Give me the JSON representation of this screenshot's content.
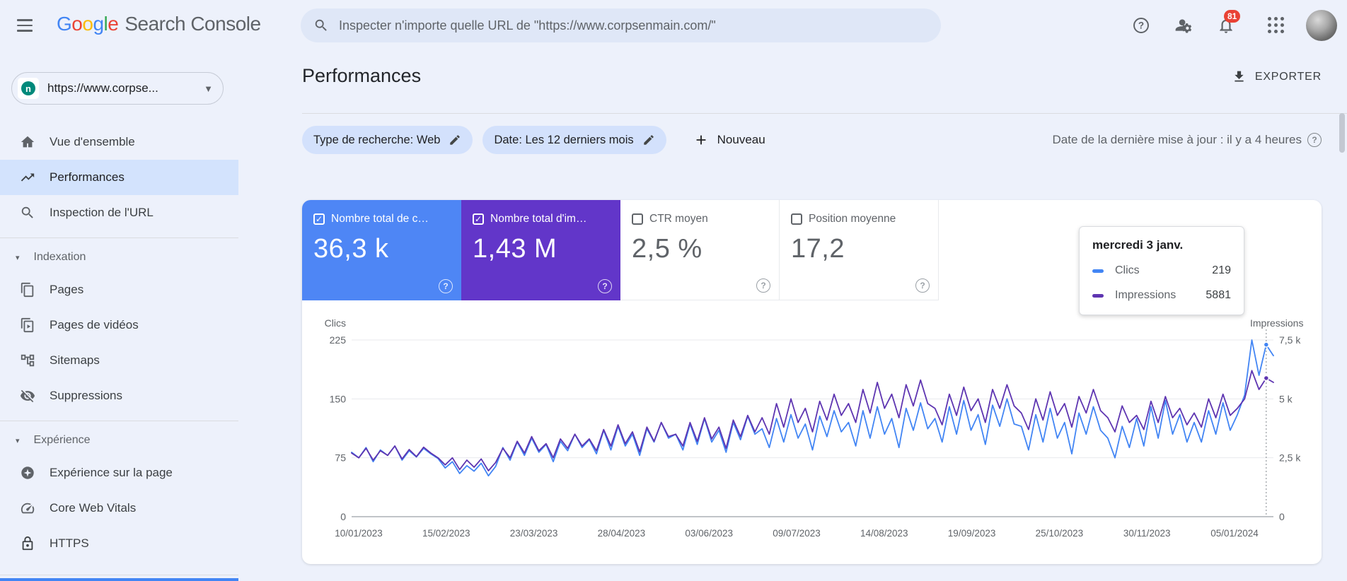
{
  "topbar": {
    "logo": {
      "letters": [
        [
          "G",
          "#4285F4"
        ],
        [
          "o",
          "#EA4335"
        ],
        [
          "o",
          "#FBBC05"
        ],
        [
          "g",
          "#4285F4"
        ],
        [
          "l",
          "#34A853"
        ],
        [
          "e",
          "#EA4335"
        ]
      ],
      "product": "Search Console"
    },
    "search_placeholder": "Inspecter n'importe quelle URL de \"https://www.corpsenmain.com/\"",
    "notifications_count": "81"
  },
  "sidebar": {
    "property_label": "https://www.corpse...",
    "sections": [
      {
        "items": [
          {
            "icon": "home",
            "label": "Vue d'ensemble"
          },
          {
            "icon": "performance",
            "label": "Performances",
            "selected": true
          },
          {
            "icon": "url-inspection",
            "label": "Inspection de l'URL"
          }
        ]
      },
      {
        "header": "Indexation",
        "items": [
          {
            "icon": "pages",
            "label": "Pages"
          },
          {
            "icon": "video-pages",
            "label": "Pages de vidéos"
          },
          {
            "icon": "sitemaps",
            "label": "Sitemaps"
          },
          {
            "icon": "removals",
            "label": "Suppressions"
          }
        ]
      },
      {
        "header": "Expérience",
        "items": [
          {
            "icon": "page-experience",
            "label": "Expérience sur la page"
          },
          {
            "icon": "core-web-vitals",
            "label": "Core Web Vitals"
          },
          {
            "icon": "https",
            "label": "HTTPS"
          }
        ]
      }
    ]
  },
  "main": {
    "title": "Performances",
    "export_label": "EXPORTER",
    "filters": [
      {
        "label": "Type de recherche: Web"
      },
      {
        "label": "Date: Les 12 derniers mois"
      }
    ],
    "new_filter_label": "Nouveau",
    "last_update": "Date de la dernière mise à jour : il y a 4 heures",
    "cards": [
      {
        "label": "Nombre total de c…",
        "value": "36,3 k",
        "checked": true,
        "bg": "#4e86f5",
        "fg": "#ffffff"
      },
      {
        "label": "Nombre total d'im…",
        "value": "1,43 M",
        "checked": true,
        "bg": "#6236c9",
        "fg": "#ffffff"
      },
      {
        "label": "CTR moyen",
        "value": "2,5 %",
        "checked": false,
        "bg": "#ffffff",
        "fg": "#5f6368"
      },
      {
        "label": "Position moyenne",
        "value": "17,2",
        "checked": false,
        "bg": "#ffffff",
        "fg": "#5f6368"
      }
    ],
    "tooltip": {
      "title": "mercredi 3 janv.",
      "rows": [
        {
          "label": "Clics",
          "value": "219",
          "color": "#4285f4"
        },
        {
          "label": "Impressions",
          "value": "5881",
          "color": "#5e35b1"
        }
      ]
    }
  },
  "chart_data": {
    "type": "line",
    "title": "",
    "grid": true,
    "legend_position": "none",
    "left_axis": {
      "label": "Clics",
      "ticks": [
        "225",
        "150",
        "75",
        "0"
      ],
      "max": 225
    },
    "right_axis": {
      "label": "Impressions",
      "ticks": [
        "7,5 k",
        "5 k",
        "2,5 k",
        "0"
      ],
      "max": 7500
    },
    "x_labels": [
      "10/01/2023",
      "15/02/2023",
      "23/03/2023",
      "28/04/2023",
      "03/06/2023",
      "09/07/2023",
      "14/08/2023",
      "19/09/2023",
      "25/10/2023",
      "30/11/2023",
      "05/01/2024"
    ],
    "hover_index": 127,
    "series": [
      {
        "name": "Clics",
        "color": "#4285f4",
        "axis": "left",
        "max": 225,
        "values": [
          82,
          75,
          88,
          70,
          85,
          78,
          90,
          72,
          84,
          76,
          87,
          80,
          74,
          62,
          70,
          55,
          65,
          58,
          68,
          52,
          64,
          88,
          72,
          95,
          78,
          100,
          82,
          92,
          70,
          96,
          84,
          105,
          88,
          98,
          80,
          110,
          85,
          115,
          90,
          105,
          78,
          112,
          95,
          120,
          100,
          105,
          85,
          118,
          92,
          125,
          95,
          110,
          82,
          120,
          98,
          128,
          105,
          112,
          88,
          125,
          95,
          130,
          100,
          118,
          85,
          128,
          102,
          135,
          108,
          120,
          90,
          135,
          100,
          140,
          105,
          125,
          88,
          138,
          110,
          145,
          112,
          125,
          95,
          140,
          105,
          148,
          110,
          130,
          92,
          142,
          115,
          150,
          118,
          115,
          85,
          130,
          95,
          138,
          100,
          120,
          80,
          132,
          105,
          140,
          110,
          100,
          75,
          115,
          88,
          125,
          90,
          140,
          100,
          148,
          105,
          130,
          95,
          120,
          95,
          135,
          105,
          145,
          110,
          130,
          155,
          225,
          180,
          219,
          205
        ]
      },
      {
        "name": "Impressions",
        "color": "#5e35b1",
        "axis": "right",
        "max": 7500,
        "values": [
          2700,
          2500,
          2900,
          2400,
          2800,
          2600,
          3000,
          2450,
          2850,
          2550,
          2950,
          2700,
          2500,
          2200,
          2500,
          2000,
          2400,
          2100,
          2450,
          1950,
          2300,
          2900,
          2500,
          3200,
          2700,
          3400,
          2800,
          3100,
          2500,
          3300,
          2900,
          3500,
          3000,
          3300,
          2800,
          3700,
          3000,
          3900,
          3100,
          3600,
          2750,
          3800,
          3200,
          4000,
          3400,
          3500,
          3000,
          4000,
          3200,
          4200,
          3300,
          3800,
          2900,
          4100,
          3400,
          4300,
          3600,
          4200,
          3500,
          4800,
          3800,
          5000,
          4000,
          4600,
          3600,
          4900,
          4100,
          5200,
          4300,
          4800,
          4000,
          5400,
          4400,
          5700,
          4600,
          5200,
          4200,
          5600,
          4700,
          5800,
          4800,
          4600,
          3900,
          5200,
          4300,
          5500,
          4500,
          5000,
          4000,
          5400,
          4600,
          5600,
          4700,
          4400,
          3700,
          5000,
          4100,
          5300,
          4300,
          4800,
          3800,
          5100,
          4400,
          5400,
          4500,
          4200,
          3600,
          4700,
          4000,
          4300,
          3700,
          4900,
          4000,
          5100,
          4200,
          4600,
          3900,
          4400,
          3800,
          5000,
          4200,
          5200,
          4300,
          4600,
          5000,
          6200,
          5400,
          5881,
          5700
        ]
      }
    ]
  }
}
